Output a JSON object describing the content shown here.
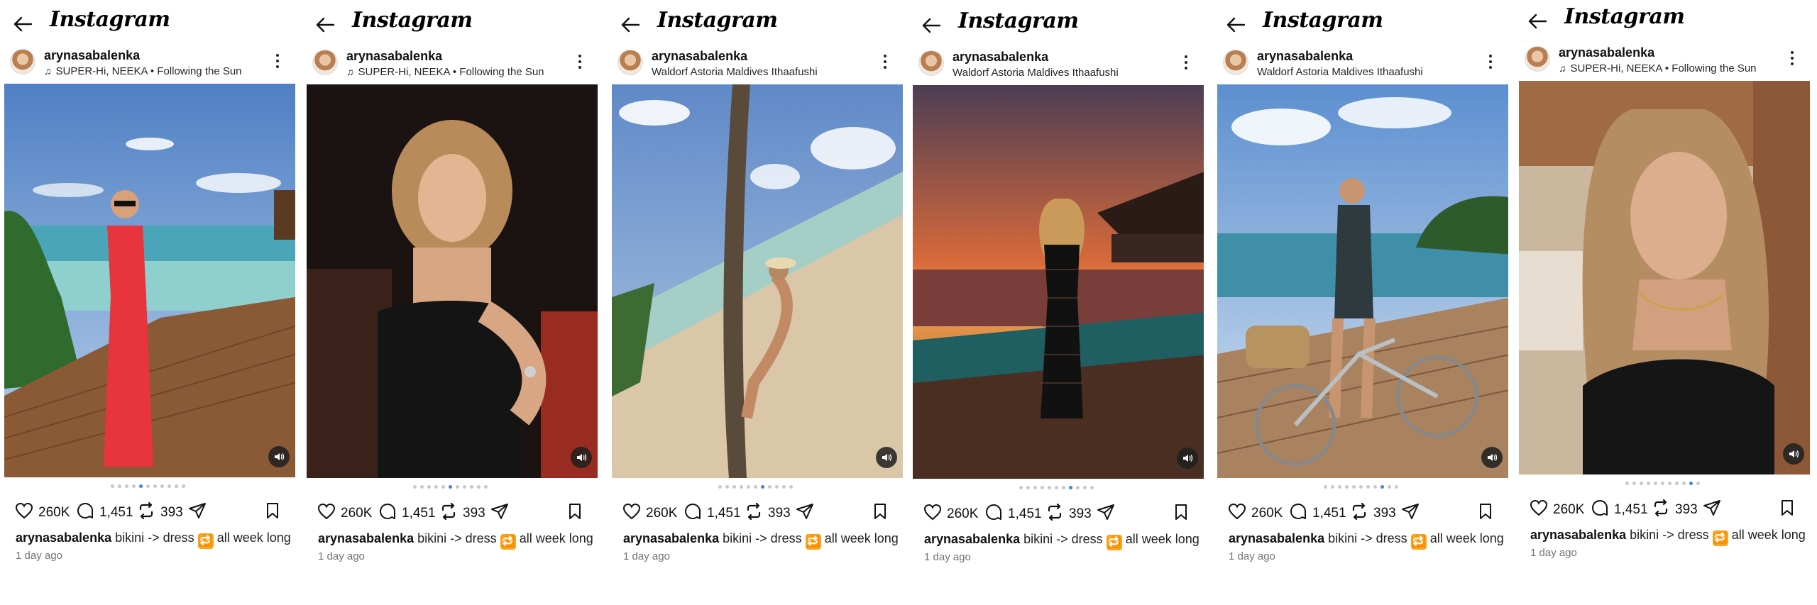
{
  "app": {
    "logo": "Instagram"
  },
  "icons": {
    "back": "arrow-left-icon",
    "more": "more-vertical-icon",
    "sound": "speaker-icon",
    "like": "heart-icon",
    "comment": "comment-icon",
    "repost": "repost-icon",
    "share": "send-icon",
    "save": "bookmark-icon",
    "music": "music-note-icon"
  },
  "colors": {
    "active_dot": "#3b82f6",
    "repost_emoji": "#f5a623"
  },
  "panels": [
    {
      "username": "arynasabalenka",
      "subtitle": "SUPER-Hi, NEEKA • Following the Sun",
      "has_music": true,
      "photo": "red-dress-beach",
      "likes": "260K",
      "comments": "1,451",
      "reposts": "393",
      "caption_user": "arynasabalenka",
      "caption_pre": "bikini -> dress",
      "caption_emoji": "🔁",
      "caption_post": "all week long",
      "time": "1 day ago",
      "active_dot": 4
    },
    {
      "username": "arynasabalenka",
      "subtitle": "SUPER-Hi, NEEKA • Following the Sun",
      "has_music": true,
      "photo": "black-dress-night",
      "likes": "260K",
      "comments": "1,451",
      "reposts": "393",
      "caption_user": "arynasabalenka",
      "caption_pre": "bikini -> dress",
      "caption_emoji": "🔁",
      "caption_post": "all week long",
      "time": "1 day ago",
      "active_dot": 5
    },
    {
      "username": "arynasabalenka",
      "subtitle": "Waldorf Astoria Maldives Ithaafushi",
      "has_music": false,
      "photo": "palm-tree-beach",
      "likes": "260K",
      "comments": "1,451",
      "reposts": "393",
      "caption_user": "arynasabalenka",
      "caption_pre": "bikini -> dress",
      "caption_emoji": "🔁",
      "caption_post": "all week long",
      "time": "1 day ago",
      "active_dot": 6
    },
    {
      "username": "arynasabalenka",
      "subtitle": "Waldorf Astoria Maldives Ithaafushi",
      "has_music": false,
      "photo": "sunset-lace-dress",
      "likes": "260K",
      "comments": "1,451",
      "reposts": "393",
      "caption_user": "arynasabalenka",
      "caption_pre": "bikini -> dress",
      "caption_emoji": "🔁",
      "caption_post": "all week long",
      "time": "1 day ago",
      "active_dot": 7
    },
    {
      "username": "arynasabalenka",
      "subtitle": "Waldorf Astoria Maldives Ithaafushi",
      "has_music": false,
      "photo": "bicycle-dock",
      "likes": "260K",
      "comments": "1,451",
      "reposts": "393",
      "caption_user": "arynasabalenka",
      "caption_pre": "bikini -> dress",
      "caption_emoji": "🔁",
      "caption_post": "all week long",
      "time": "1 day ago",
      "active_dot": 8
    },
    {
      "username": "arynasabalenka",
      "subtitle": "SUPER-Hi, NEEKA • Following the Sun",
      "has_music": true,
      "photo": "selfie-room",
      "likes": "260K",
      "comments": "1,451",
      "reposts": "393",
      "caption_user": "arynasabalenka",
      "caption_pre": "bikini -> dress",
      "caption_emoji": "🔁",
      "caption_post": "all week long",
      "time": "1 day ago",
      "active_dot": 9
    }
  ]
}
